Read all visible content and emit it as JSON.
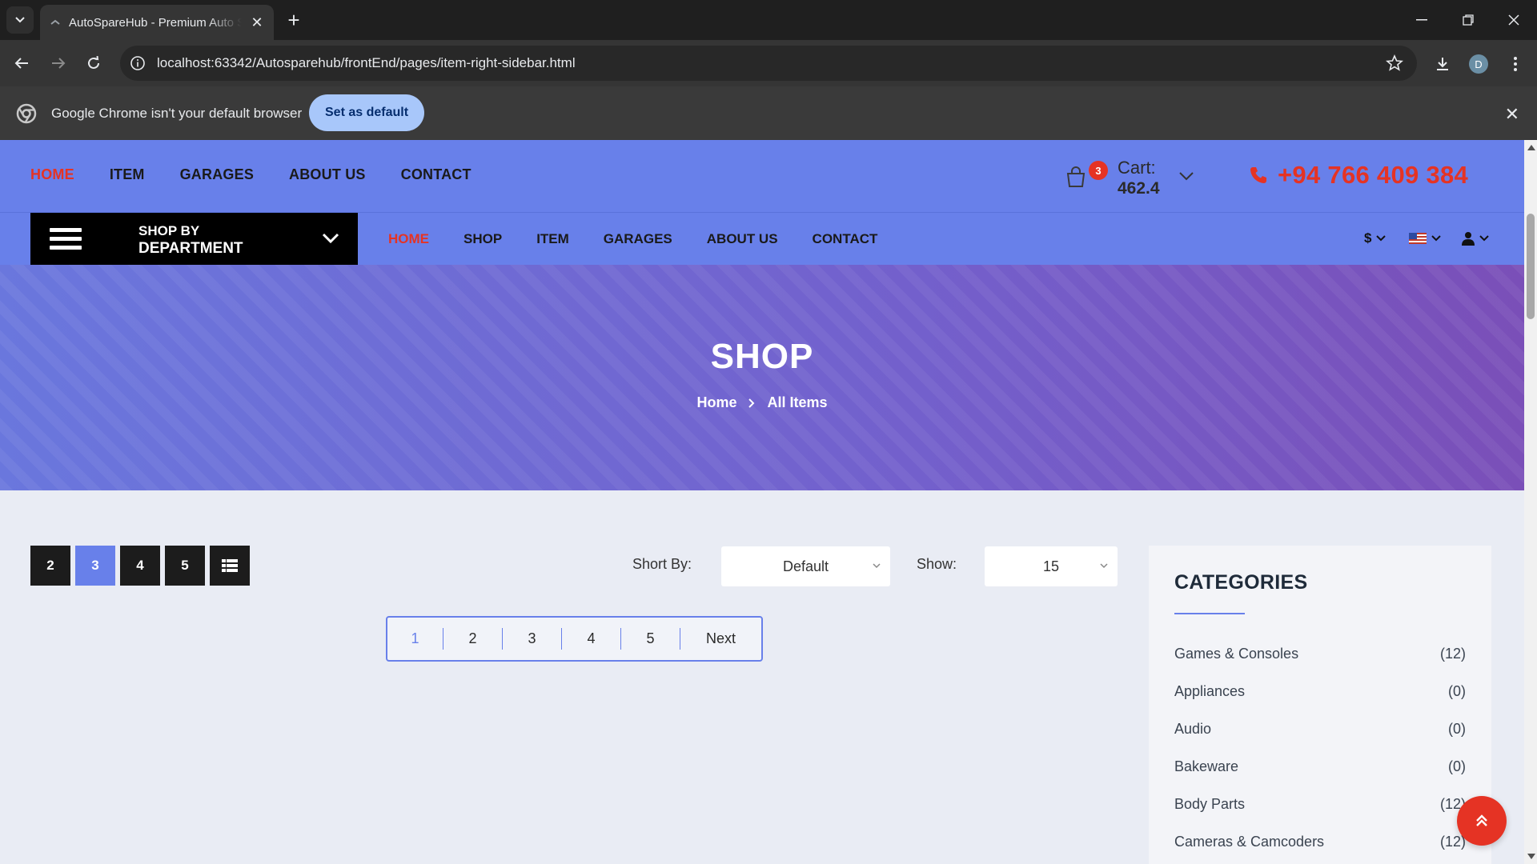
{
  "browser": {
    "tab_title": "AutoSpareHub - Premium Auto Spare Parts",
    "url": "localhost:63342/Autosparehub/frontEnd/pages/item-right-sidebar.html",
    "avatar_letter": "D",
    "infobar_text": "Google Chrome isn't your default browser",
    "infobar_button": "Set as default"
  },
  "top_nav": [
    "HOME",
    "ITEM",
    "GARAGES",
    "ABOUT US",
    "CONTACT"
  ],
  "cart": {
    "count": "3",
    "label": "Cart:",
    "total": "462.4"
  },
  "phone": "+94 766 409 384",
  "department": {
    "line1": "SHOP BY",
    "line2": "DEPARTMENT"
  },
  "main_nav": [
    "HOME",
    "SHOP",
    "ITEM",
    "GARAGES",
    "ABOUT US",
    "CONTACT"
  ],
  "tools": {
    "currency": "$"
  },
  "banner": {
    "title": "SHOP",
    "crumb_home": "Home",
    "crumb_current": "All Items"
  },
  "view_buttons": [
    "2",
    "3",
    "4",
    "5"
  ],
  "sort": {
    "label": "Short By:",
    "value": "Default"
  },
  "show": {
    "label": "Show:",
    "value": "15"
  },
  "pagination": [
    "1",
    "2",
    "3",
    "4",
    "5",
    "Next"
  ],
  "categories": {
    "title": "CATEGORIES",
    "items": [
      {
        "name": "Games & Consoles",
        "count": "(12)"
      },
      {
        "name": "Appliances",
        "count": "(0)"
      },
      {
        "name": "Audio",
        "count": "(0)"
      },
      {
        "name": "Bakeware",
        "count": "(0)"
      },
      {
        "name": "Body Parts",
        "count": "(12)"
      },
      {
        "name": "Cameras & Camcoders",
        "count": "(12)"
      }
    ]
  },
  "colors": {
    "accent": "#6880ea",
    "brand_red": "#e53324",
    "dark": "#1c1c1c"
  }
}
